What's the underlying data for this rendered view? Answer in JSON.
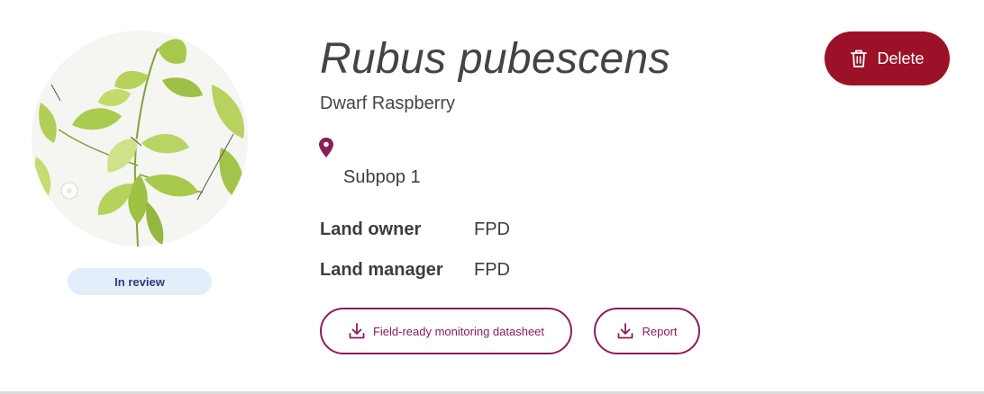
{
  "species": {
    "scientific_name": "Rubus pubescens",
    "common_name": "Dwarf Raspberry",
    "image_icon": "plant-illustration"
  },
  "status": {
    "label": "In review",
    "color": "#e3eefb",
    "text_color": "#2d3c7c"
  },
  "location": {
    "icon": "map-pin-icon",
    "subpopulation": "Subpop 1",
    "color": "#8a1d5a"
  },
  "details": [
    {
      "label": "Land owner",
      "value": "FPD"
    },
    {
      "label": "Land manager",
      "value": "FPD"
    }
  ],
  "actions": {
    "datasheet_label": "Field-ready monitoring datasheet",
    "report_label": "Report",
    "download_icon": "download-icon",
    "delete_label": "Delete",
    "delete_icon": "trash-icon"
  },
  "colors": {
    "accent": "#8a1d5a",
    "danger": "#9b1228",
    "text": "#3d3d3d"
  }
}
